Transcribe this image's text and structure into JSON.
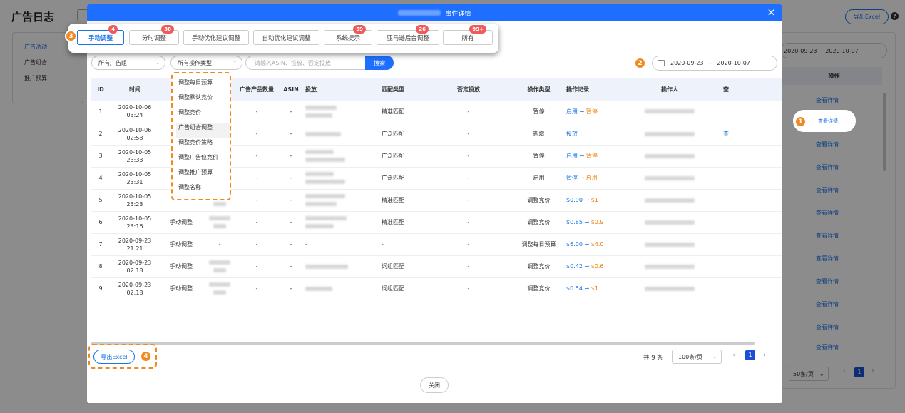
{
  "page": {
    "title": "广告日志",
    "export_label": "导出Excel",
    "help_icon": "?",
    "sidebar": [
      "广告活动",
      "广告组合",
      "推广预算"
    ],
    "date_range": "2020-09-23  ~  2020-10-07",
    "col_action": "操作",
    "row_link": "查看详情",
    "page_size": "50条/页",
    "page_current": "1",
    "prev": "‹",
    "next": "›"
  },
  "callouts": {
    "c1": "1",
    "c2": "2",
    "c3": "3",
    "c4": "4"
  },
  "modal": {
    "title": "事件详情",
    "close_icon": "×",
    "tabs": [
      {
        "label": "手动调整",
        "count": "4"
      },
      {
        "label": "分时调整",
        "count": "38"
      },
      {
        "label": "手动优化建议调整",
        "count": ""
      },
      {
        "label": "自动优化建议调整",
        "count": ""
      },
      {
        "label": "系统提示",
        "count": "59"
      },
      {
        "label": "亚马逊后台调整",
        "count": "26"
      },
      {
        "label": "所有",
        "count": "99+"
      }
    ],
    "filters": {
      "ad_group": "所有广告组",
      "op_type": "所有操作类型",
      "search_placeholder": "请输入ASIN、投放、否定投放",
      "search_button": "搜索",
      "date_start": "2020-09-23",
      "date_sep": "-",
      "date_end": "2020-10-07"
    },
    "op_type_options": [
      "调整每日预算",
      "调整默认竞价",
      "调整竞价",
      "广告组合调整",
      "调整竞价策略",
      "调整广告位竞价",
      "调整推广预算",
      "调整名称"
    ],
    "columns": [
      "ID",
      "时间",
      "",
      "广告组",
      "广告产品数量",
      "ASIN",
      "投放",
      "匹配类型",
      "否定投放",
      "操作类型",
      "操作记录",
      "操作人",
      "查"
    ],
    "rows": [
      {
        "id": "1",
        "date": "2020-10-06",
        "time": "03:24",
        "kind": "",
        "count": "-",
        "asin": "-",
        "match": "精准匹配",
        "neg": "-",
        "op": "暂停",
        "rec_a": "启用",
        "rec_b": "暂停",
        "extra": ""
      },
      {
        "id": "2",
        "date": "2020-10-06",
        "time": "02:58",
        "kind": "",
        "count": "-",
        "asin": "-",
        "match": "广泛匹配",
        "neg": "-",
        "op": "新增",
        "rec_a": "投放",
        "rec_b": "",
        "extra": "查"
      },
      {
        "id": "3",
        "date": "2020-10-05",
        "time": "23:33",
        "kind": "",
        "count": "-",
        "asin": "-",
        "match": "广泛匹配",
        "neg": "-",
        "op": "暂停",
        "rec_a": "启用",
        "rec_b": "暂停",
        "extra": ""
      },
      {
        "id": "4",
        "date": "2020-10-05",
        "time": "23:31",
        "kind": "",
        "count": "-",
        "asin": "-",
        "match": "广泛匹配",
        "neg": "-",
        "op": "启用",
        "rec_a": "暂停",
        "rec_b": "启用",
        "extra": ""
      },
      {
        "id": "5",
        "date": "2020-10-05",
        "time": "23:23",
        "kind": "",
        "count": "-",
        "asin": "-",
        "match": "精准匹配",
        "neg": "-",
        "op": "调整竞价",
        "rec_a": "$0.90",
        "rec_b": "$1",
        "extra": ""
      },
      {
        "id": "6",
        "date": "2020-10-05",
        "time": "23:16",
        "kind": "手动调整",
        "count": "-",
        "asin": "-",
        "match": "精准匹配",
        "neg": "-",
        "op": "调整竞价",
        "rec_a": "$0.85",
        "rec_b": "$0.9",
        "extra": ""
      },
      {
        "id": "7",
        "date": "2020-09-23",
        "time": "21:21",
        "kind": "手动调整",
        "count": "-",
        "asin": "-",
        "match": "-",
        "neg": "-",
        "op": "调整每日预算",
        "rec_a": "$6.00",
        "rec_b": "$4.0",
        "extra": ""
      },
      {
        "id": "8",
        "date": "2020-09-23",
        "time": "02:18",
        "kind": "手动调整",
        "count": "-",
        "asin": "-",
        "match": "词组匹配",
        "neg": "-",
        "op": "调整竞价",
        "rec_a": "$0.42",
        "rec_b": "$0.6",
        "extra": ""
      },
      {
        "id": "9",
        "date": "2020-09-23",
        "time": "02:18",
        "kind": "手动调整",
        "count": "-",
        "asin": "-",
        "match": "词组匹配",
        "neg": "-",
        "op": "调整竞价",
        "rec_a": "$0.54",
        "rec_b": "$1",
        "extra": ""
      }
    ],
    "arrow": "→",
    "dash": "-",
    "export_label": "导出Excel",
    "total": "共 9 条",
    "page_size": "100条/页",
    "page_current": "1",
    "prev": "‹",
    "next": "›",
    "close_label": "关闭"
  }
}
